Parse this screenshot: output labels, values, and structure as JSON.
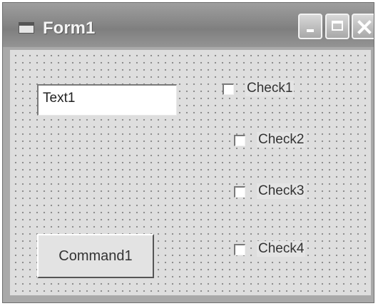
{
  "window": {
    "title": "Form1"
  },
  "form": {
    "textbox_value": "Text1",
    "command_label": "Command1",
    "checkboxes": [
      {
        "label": "Check1",
        "checked": false
      },
      {
        "label": "Check2",
        "checked": false
      },
      {
        "label": "Check3",
        "checked": false
      },
      {
        "label": "Check4",
        "checked": false
      }
    ]
  },
  "icons": {
    "app": "form-icon",
    "minimize": "minimize-icon",
    "maximize": "maximize-icon",
    "close": "close-icon"
  },
  "colors": {
    "titlebar": "#8a8a8a",
    "client_background": "#dedede",
    "grid_dots": "#8a8a8a"
  }
}
